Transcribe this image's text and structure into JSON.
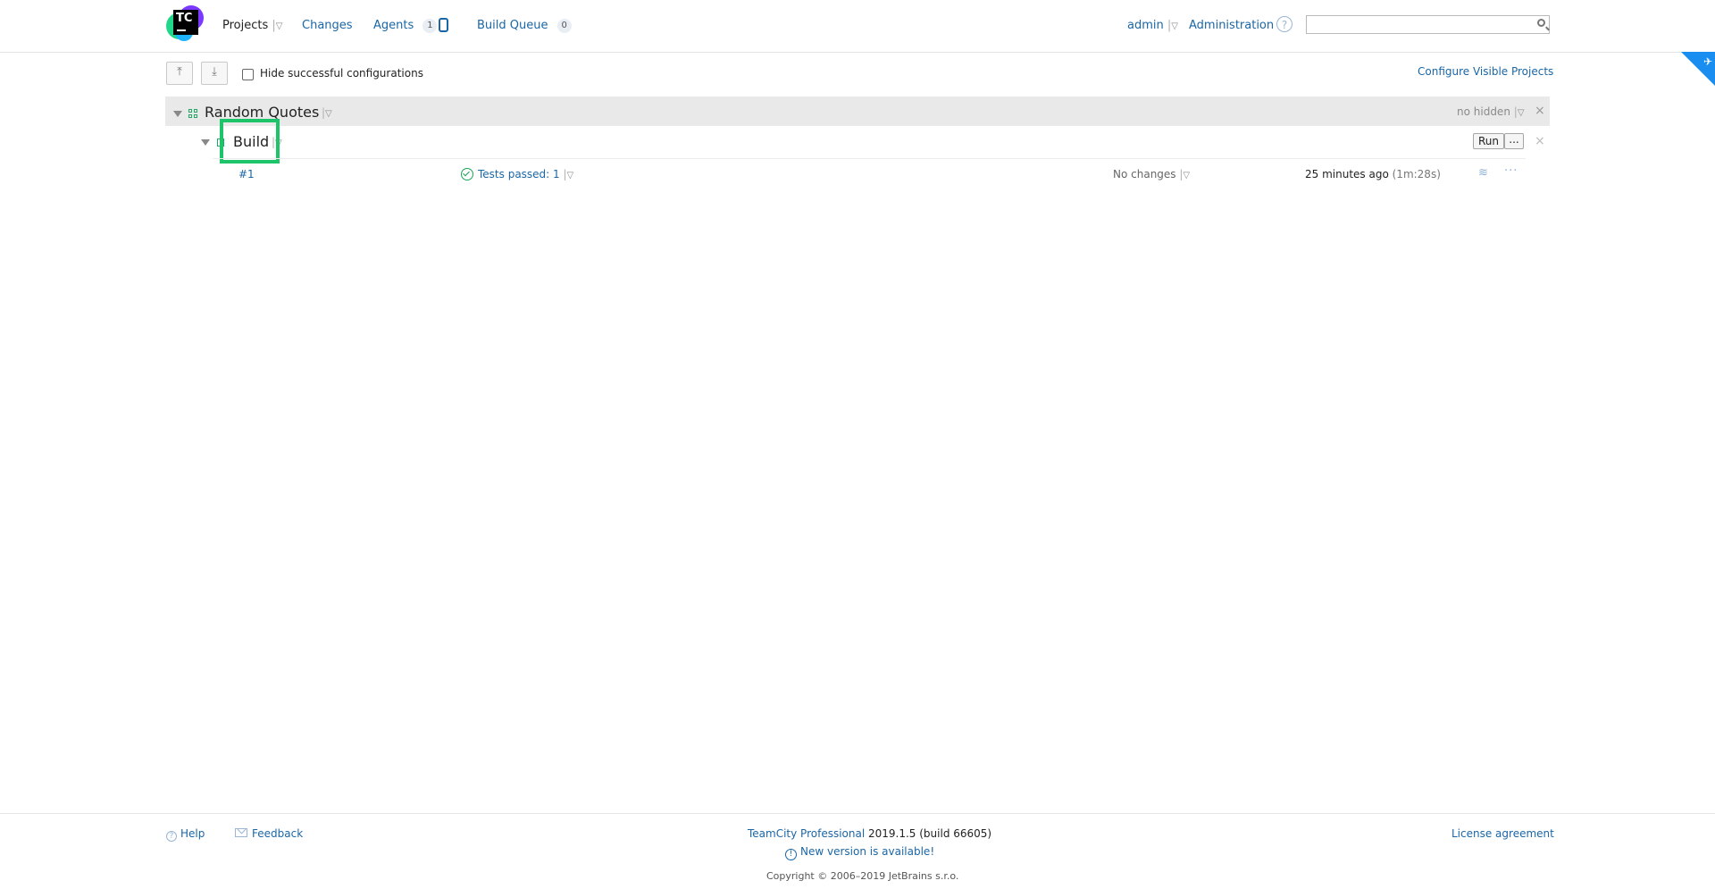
{
  "header": {
    "logo_text": "TC",
    "nav": {
      "projects": "Projects",
      "changes": "Changes",
      "agents": "Agents",
      "agents_count": "1",
      "build_queue": "Build Queue",
      "build_queue_count": "0"
    },
    "user": "admin",
    "administration": "Administration",
    "help_glyph": "?",
    "search": {
      "value": "",
      "placeholder": ""
    }
  },
  "toolbar": {
    "collapse_all_glyph": "⤒",
    "expand_all_glyph": "⤓",
    "hide_successful_label": "Hide successful configurations",
    "hide_successful_checked": false,
    "configure_visible_projects": "Configure Visible Projects"
  },
  "project": {
    "name": "Random Quotes",
    "no_hidden": "no hidden",
    "close_glyph": "×",
    "build_configuration": {
      "name": "Build",
      "run_label": "Run",
      "more_label": "...",
      "close_glyph": "×",
      "last_build": {
        "number": "#1",
        "status": "Tests passed: 1",
        "changes": "No changes",
        "time": "25 minutes ago",
        "duration": "(1m:28s)"
      }
    }
  },
  "footer": {
    "help": "Help",
    "feedback": "Feedback",
    "product": "TeamCity Professional",
    "version": "2019.1.5 (build 66605)",
    "new_version": "New version is available!",
    "copyright": "Copyright © 2006–2019 JetBrains s.r.o.",
    "license": "License agreement"
  }
}
